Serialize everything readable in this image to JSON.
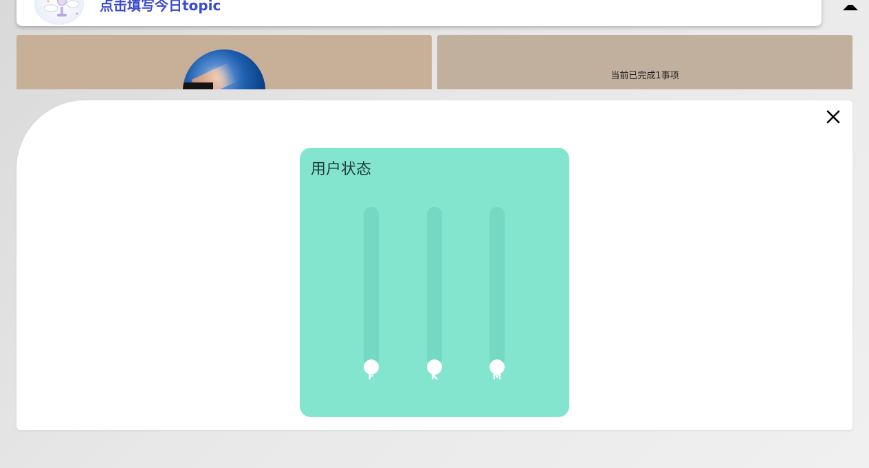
{
  "header": {
    "topic_link": "点击填写今日topic"
  },
  "tiles": {
    "progress_text": "当前已完成1事项"
  },
  "modal": {
    "panel_title": "用户状态",
    "sliders": [
      {
        "label": "F",
        "value": 0
      },
      {
        "label": "K",
        "value": 0
      },
      {
        "label": "M",
        "value": 0
      }
    ]
  },
  "colors": {
    "panel_bg": "#84e5cf",
    "track": "#75d8c2",
    "link": "#3b4ad0"
  }
}
